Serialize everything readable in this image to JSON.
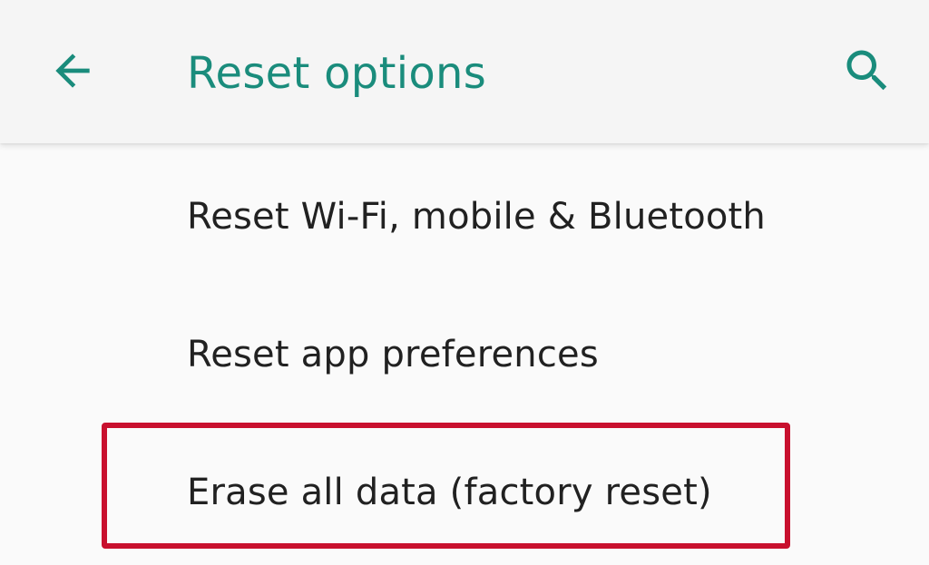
{
  "colors": {
    "accent": "#1a8c7c",
    "highlight": "#c8102e",
    "text_primary": "#212121"
  },
  "toolbar": {
    "back_icon": "arrow-back-icon",
    "title": "Reset options",
    "search_icon": "search-icon"
  },
  "options": {
    "items": [
      {
        "label": "Reset Wi-Fi, mobile & Bluetooth"
      },
      {
        "label": "Reset app preferences"
      },
      {
        "label": "Erase all data (factory reset)",
        "highlighted": true
      }
    ]
  }
}
